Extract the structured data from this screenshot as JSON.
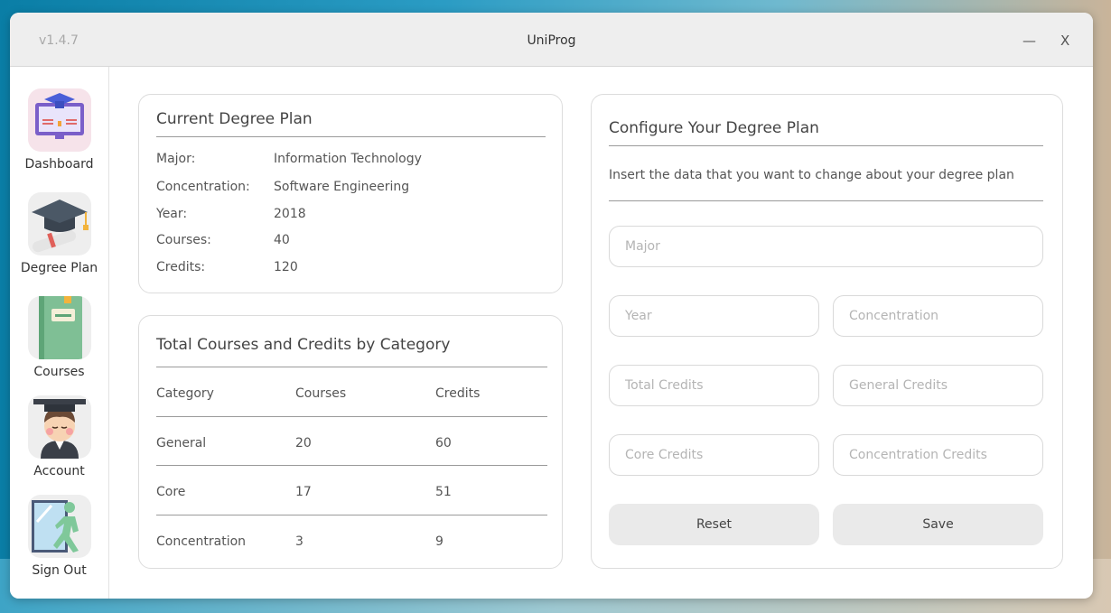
{
  "window": {
    "version": "v1.4.7",
    "title": "UniProg",
    "minimize": "—",
    "close": "X"
  },
  "sidebar": {
    "items": [
      {
        "label": "Dashboard",
        "icon": "dashboard-icon"
      },
      {
        "label": "Degree Plan",
        "icon": "graduation-cap-icon"
      },
      {
        "label": "Courses",
        "icon": "book-icon"
      },
      {
        "label": "Account",
        "icon": "student-avatar-icon"
      },
      {
        "label": "Sign Out",
        "icon": "exit-door-icon"
      }
    ]
  },
  "current_plan": {
    "title": "Current Degree Plan",
    "rows": [
      {
        "label": "Major:",
        "value": "Information Technology"
      },
      {
        "label": "Concentration:",
        "value": "Software Engineering"
      },
      {
        "label": "Year:",
        "value": "2018"
      },
      {
        "label": "Courses:",
        "value": "40"
      },
      {
        "label": "Credits:",
        "value": "120"
      }
    ]
  },
  "totals": {
    "title": "Total Courses and Credits by Category",
    "headers": [
      "Category",
      "Courses",
      "Credits"
    ],
    "rows": [
      [
        "General",
        "20",
        "60"
      ],
      [
        "Core",
        "17",
        "51"
      ],
      [
        "Concentration",
        "3",
        "9"
      ]
    ]
  },
  "configure": {
    "title": "Configure Your Degree Plan",
    "description": "Insert the data that you want to change about your degree plan",
    "fields": {
      "major": "Major",
      "year": "Year",
      "concentration": "Concentration",
      "total_credits": "Total Credits",
      "general_credits": "General Credits",
      "core_credits": "Core Credits",
      "concentration_credits": "Concentration Credits"
    },
    "reset_label": "Reset",
    "save_label": "Save"
  }
}
